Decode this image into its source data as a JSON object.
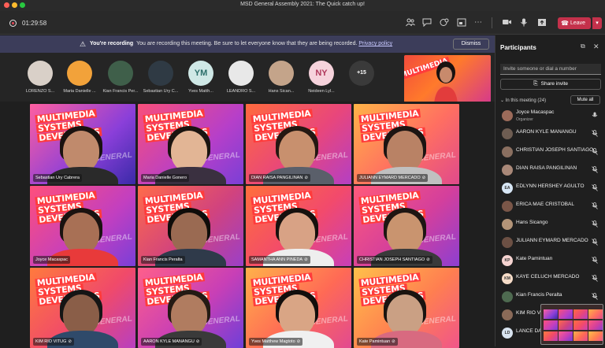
{
  "window": {
    "title": "MSD General Assembly 2021: The Quick catch up!"
  },
  "toolbar": {
    "timer": "01:29:58",
    "icons": [
      "participants-icon",
      "chat-icon",
      "reactions-icon",
      "rooms-icon",
      "more-icon",
      "camera-icon",
      "mic-icon",
      "share-icon"
    ],
    "leave_label": "Leave"
  },
  "banner": {
    "bold": "You're recording",
    "message": "You are recording this meeting. Be sure to let everyone know that they are being recorded.",
    "link": "Privacy policy",
    "dismiss": "Dismiss"
  },
  "strip": {
    "avatars": [
      {
        "name": "LORENZO S...",
        "initials": "",
        "color": "#d9d0c8"
      },
      {
        "name": "Maria Danielle ...",
        "initials": "",
        "color": "#f2a23a"
      },
      {
        "name": "Kian Francis Per...",
        "initials": "",
        "color": "#3f5f4a"
      },
      {
        "name": "Sebastian Ury C...",
        "initials": "",
        "color": "#2f3a44"
      },
      {
        "name": "Yves Matth...",
        "initials": "YM",
        "color": "#cfe8e6"
      },
      {
        "name": "LEANDRO S...",
        "initials": "",
        "color": "#e8e8e8"
      },
      {
        "name": "Hans Sican...",
        "initials": "",
        "color": "#c4a48a"
      },
      {
        "name": "Neideen Lyl...",
        "initials": "NY",
        "color": "#f6d3dc"
      }
    ],
    "overflow": "+15"
  },
  "tiles": [
    {
      "name": "Sebastian Ury Cabrera",
      "muted": false,
      "bg": "linear-gradient(135deg,#ff5fa0,#8a3fd9 60%,#3a2aa8)"
    },
    {
      "name": "Maria Danielle  Gonero",
      "muted": false,
      "bg": "linear-gradient(135deg,#f94f7a,#b63fc9 60%,#7b3fd6)"
    },
    {
      "name": "DIAN RAISA PANGILINAN",
      "muted": true,
      "bg": "linear-gradient(135deg,#ff6a3d,#e8467c 55%,#b43fc4)"
    },
    {
      "name": "JULIANN EYMARD MERCADO",
      "muted": true,
      "bg": "linear-gradient(135deg,#ffb347,#ff6f61 55%,#e04a8c)"
    },
    {
      "name": "Joyce Macaspac",
      "muted": false,
      "bg": "linear-gradient(135deg,#ff4f7b,#c23fc0 60%,#7a3fd8)"
    },
    {
      "name": "Kian Francis  Peralta",
      "muted": false,
      "bg": "linear-gradient(135deg,#ff6b4a,#d1437e 55%,#9b3fc8)"
    },
    {
      "name": "SAMANTHA ANN PINEDA",
      "muted": true,
      "bg": "linear-gradient(135deg,#ff6f3c,#f24a6c 55%,#c83fb8)"
    },
    {
      "name": "CHRISTIAN JOSEPH SANTIAGO",
      "muted": true,
      "bg": "linear-gradient(135deg,#ff5a7a,#d43f9c 55%,#8d3fd1)"
    },
    {
      "name": "KIM RIO VITUG",
      "muted": true,
      "bg": "linear-gradient(135deg,#ff7a3d,#f04a6a 55%,#b83fc0)"
    },
    {
      "name": "AARON KYLE MANANGU",
      "muted": true,
      "bg": "linear-gradient(135deg,#ff5f8a,#c83fb6 55%,#6f3fd8)"
    },
    {
      "name": "Yves Matthew Magtoto",
      "muted": true,
      "bg": "linear-gradient(135deg,#ffb14a,#ff6a55 55%,#e24a90)"
    },
    {
      "name": "Kate Pamintuan",
      "muted": true,
      "bg": "linear-gradient(135deg,#ffc04a,#ff7f50 55%,#f0558a)"
    }
  ],
  "tile_brand": [
    "MULTIMEDIA",
    "SYSTEMS",
    "DEVELOPERS"
  ],
  "tile_watermark": "GENERAL ASSEMBLY",
  "panel": {
    "title": "Participants",
    "invite_placeholder": "Invite someone or dial a number",
    "share_invite": "Share invite",
    "in_meeting": "In this meeting (24)",
    "mute_all": "Mute all",
    "participants": [
      {
        "name": "Joyce Macaspac",
        "role": "Organizer",
        "initials": "",
        "color": "#9c6b5a",
        "muted": false
      },
      {
        "name": "AARON KYLE MANANGU",
        "role": "",
        "initials": "",
        "color": "#6e5d52",
        "muted": true
      },
      {
        "name": "CHRISTIAN JOSEPH SANTIAGO",
        "role": "",
        "initials": "",
        "color": "#8a6f60",
        "muted": true
      },
      {
        "name": "DIAN RAISA PANGILINAN",
        "role": "",
        "initials": "",
        "color": "#a98878",
        "muted": true
      },
      {
        "name": "EDLYNN HERSHEY AGULTO",
        "role": "",
        "initials": "EA",
        "color": "#d7e6f5",
        "muted": true
      },
      {
        "name": "ERICA MAE CRISTOBAL",
        "role": "",
        "initials": "",
        "color": "#7a5648",
        "muted": true
      },
      {
        "name": "Hans Sicango",
        "role": "",
        "initials": "",
        "color": "#b39478",
        "muted": true
      },
      {
        "name": "JULIANN EYMARD MERCADO",
        "role": "",
        "initials": "",
        "color": "#6c5044",
        "muted": true
      },
      {
        "name": "Kate Pamintuan",
        "role": "",
        "initials": "KP",
        "color": "#f5d3d0",
        "muted": true
      },
      {
        "name": "KAYE CELUCH MERCADO",
        "role": "",
        "initials": "KM",
        "color": "#f6dcc8",
        "muted": true
      },
      {
        "name": "Kian Francis Peralta",
        "role": "",
        "initials": "",
        "color": "#4e6a50",
        "muted": true
      },
      {
        "name": "KIM RIO VI",
        "role": "",
        "initials": "",
        "color": "#8a6a58",
        "muted": true
      },
      {
        "name": "LANCE DA",
        "role": "",
        "initials": "LD",
        "color": "#d8e3ef",
        "muted": true
      }
    ]
  },
  "colors": {
    "leave": "#c4314b",
    "banner": "#3c3d5a",
    "panel_bg": "#1f1f1f"
  }
}
